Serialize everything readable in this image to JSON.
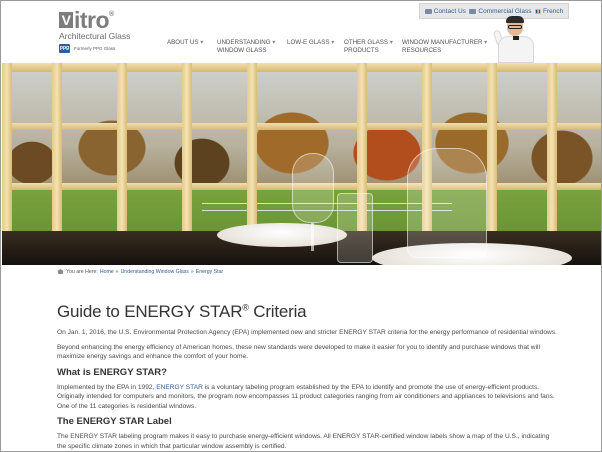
{
  "header": {
    "logo_word": "itro",
    "logo_letter": "V",
    "logo_tm": "®",
    "logo_sub": "Architectural Glass",
    "ppg_badge": "ppg",
    "ppg_text": "Formerly PPG Glass"
  },
  "topbar": {
    "contact": "Contact Us",
    "commercial": "Commercial Glass",
    "french": "French"
  },
  "nav": [
    {
      "line1": "ABOUT US",
      "line2": ""
    },
    {
      "line1": "UNDERSTANDING",
      "line2": "WINDOW GLASS"
    },
    {
      "line1": "LOW-E GLASS",
      "line2": ""
    },
    {
      "line1": "OTHER GLASS",
      "line2": "PRODUCTS"
    },
    {
      "line1": "WINDOW MANUFACTURER",
      "line2": "RESOURCES"
    }
  ],
  "breadcrumb": {
    "prefix": "You are Here:",
    "home": "Home",
    "sep": "»",
    "section": "Understanding Window Glass",
    "current": "Energy Star"
  },
  "main": {
    "title": "Guide to ENERGY STAR",
    "title_reg": "®",
    "title_suffix": " Criteria",
    "p1": "On Jan. 1, 2016, the U.S. Environmental Protection Agency (EPA) implemented new and stricter ENERGY STAR criteria for the energy performance of residential windows.",
    "p2": "Beyond enhancing the energy efficiency of American homes, these new standards were developed to make it easier for you to identify and purchase windows that will maximize energy savings and enhance the comfort of your home.",
    "h1": "What is ENERGY STAR?",
    "p3_a": "Implemented by the EPA in 1992, ",
    "p3_link": "ENERGY STAR",
    "p3_b": " is a voluntary labeling program established by the EPA to identify and promote the use of energy-efficient products. Originally intended for computers and monitors, the program now encompasses 11 product categories ranging from air conditioners and appliances to televisions and fans. One of the 11 categories is residential windows.",
    "h2": "The ENERGY STAR Label",
    "p4": "The ENERGY STAR labeling program makes it easy to purchase energy-efficient windows. All ENERGY STAR-certified window labels show a map of the U.S., indicating the specific climate zones in which that particular window assembly is certified."
  }
}
